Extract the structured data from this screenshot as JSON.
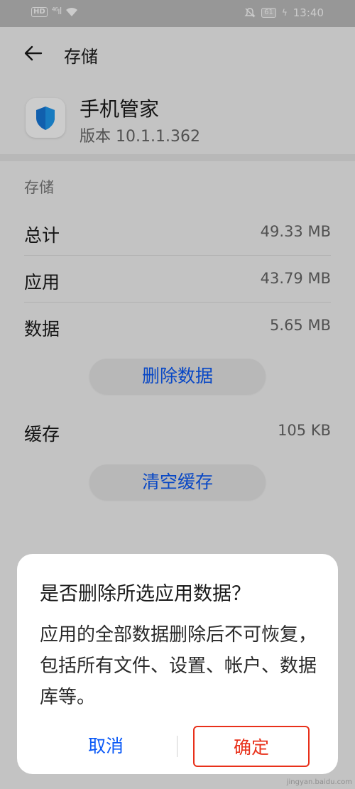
{
  "status_bar": {
    "hd": "HD",
    "signal": "⁴⁶ıl",
    "battery": "61",
    "time": "13:40"
  },
  "header": {
    "title": "存储"
  },
  "app": {
    "name": "手机管家",
    "version": "版本 10.1.1.362"
  },
  "storage": {
    "section_title": "存储",
    "rows": [
      {
        "label": "总计",
        "value": "49.33 MB"
      },
      {
        "label": "应用",
        "value": "43.79 MB"
      },
      {
        "label": "数据",
        "value": "5.65 MB"
      }
    ],
    "clear_data_label": "删除数据",
    "cache": {
      "label": "缓存",
      "value": "105 KB"
    },
    "clear_cache_label": "清空缓存"
  },
  "dialog": {
    "title": "是否删除所选应用数据？",
    "message": "应用的全部数据删除后不可恢复，包括所有文件、设置、帐户、数据库等。",
    "cancel_label": "取消",
    "confirm_label": "确定"
  },
  "colors": {
    "accent": "#0a59f7",
    "danger": "#e8301a"
  },
  "watermark": "jingyan.baidu.com"
}
